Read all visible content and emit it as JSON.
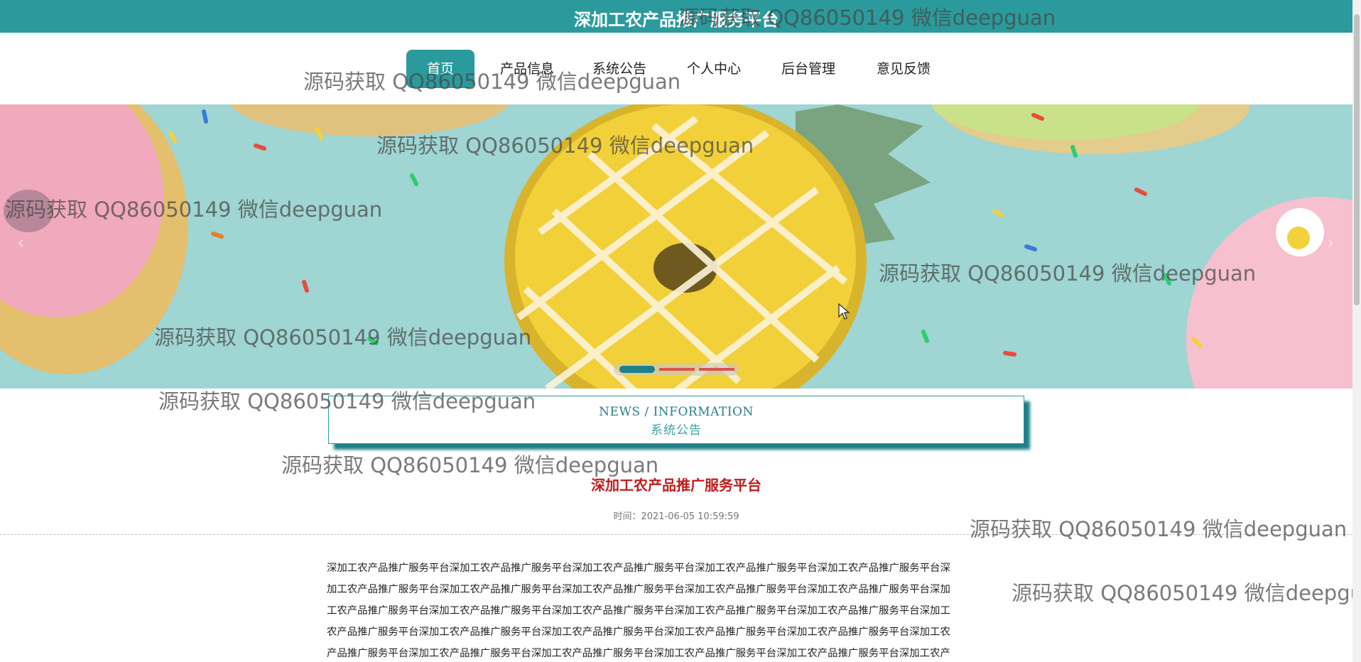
{
  "header": {
    "site_title": "深加工农产品推广服务平台"
  },
  "nav": {
    "items": [
      {
        "label": "首页",
        "active": true
      },
      {
        "label": "产品信息",
        "active": false
      },
      {
        "label": "系统公告",
        "active": false
      },
      {
        "label": "个人中心",
        "active": false
      },
      {
        "label": "后台管理",
        "active": false
      },
      {
        "label": "意见反馈",
        "active": false
      }
    ]
  },
  "carousel": {
    "prev_icon": "chevron-left-icon",
    "next_icon": "chevron-right-icon",
    "slide_count": 3,
    "active_index": 0
  },
  "news_section": {
    "title_en": "NEWS / INFORMATION",
    "title_cn": "系统公告"
  },
  "article": {
    "title": "深加工农产品推广服务平台",
    "time_label": "时间：",
    "time_value": "2021-06-05 10:59:59",
    "body_lines": [
      "深加工农产品推广服务平台深加工农产品推广服务平台深加工农产品推广服务平台深加工农产品推广服务平台深加工农产品推广服务平台深",
      "加工农产品推广服务平台深加工农产品推广服务平台深加工农产品推广服务平台深加工农产品推广服务平台深加工农产品推广服务平台深加",
      "工农产品推广服务平台深加工农产品推广服务平台深加工农产品推广服务平台深加工农产品推广服务平台深加工农产品推广服务平台深加工",
      "农产品推广服务平台深加工农产品推广服务平台深加工农产品推广服务平台深加工农产品推广服务平台深加工农产品推广服务平台深加工农",
      "产品推广服务平台深加工农产品推广服务平台深加工农产品推广服务平台深加工农产品推广服务平台深加工农产品推广服务平台深加工农产"
    ]
  },
  "watermark": {
    "text": "源码获取 QQ86050149 微信deepguan"
  },
  "colors": {
    "primary": "#2b9a9c",
    "article_title": "#c21a1a",
    "indicator_active": "#1f7f87",
    "indicator_inactive": "#d9534f"
  }
}
